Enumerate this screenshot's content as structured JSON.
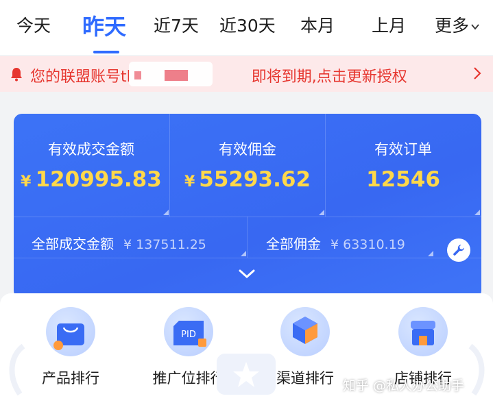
{
  "tabs": {
    "items": [
      "今天",
      "昨天",
      "近7天",
      "近30天",
      "本月",
      "上月"
    ],
    "active_index": 1,
    "more_label": "更多"
  },
  "notice": {
    "text": "您的联盟账号tl　　　　　　　　即将到期,点击更新授权"
  },
  "stats": {
    "primary": [
      {
        "label": "有效成交金额",
        "currency": "¥",
        "value": "120995.83"
      },
      {
        "label": "有效佣金",
        "currency": "¥",
        "value": "55293.62"
      },
      {
        "label": "有效订单",
        "currency": "",
        "value": "12546"
      }
    ],
    "secondary": [
      {
        "label": "全部成交金额",
        "value": "¥ 137511.25"
      },
      {
        "label": "全部佣金",
        "value": "¥ 63310.19"
      }
    ]
  },
  "rankings": [
    {
      "label": "产品排行",
      "icon": "bag-icon"
    },
    {
      "label": "推广位排行",
      "icon": "pid-icon",
      "icon_text": "PID"
    },
    {
      "label": "渠道排行",
      "icon": "cube-icon"
    },
    {
      "label": "店铺排行",
      "icon": "store-icon"
    }
  ],
  "watermark": "知乎 @私人办公助手",
  "colors": {
    "accent": "#2f6bff",
    "card_bg": "#3868f2",
    "highlight_value": "#ffd84a",
    "notice_text": "#e6362f",
    "notice_bg": "#fde9ea"
  }
}
